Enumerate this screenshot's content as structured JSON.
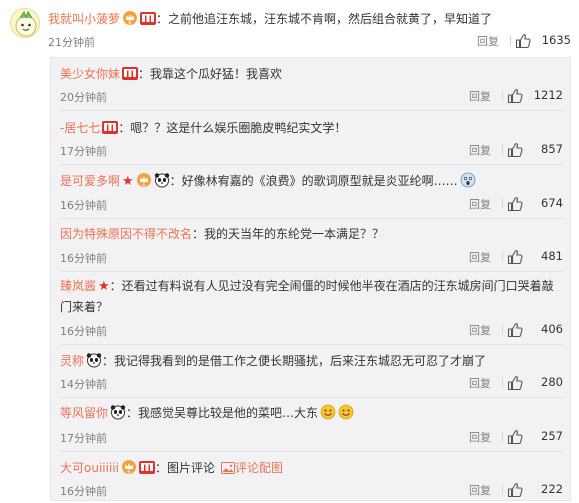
{
  "top_comment": {
    "user": "我就叫小菠萝",
    "text": "：之前他追汪东城，汪东城不肯啊，然后组合就黄了，早知道了",
    "time": "21分钟前",
    "reply_label": "回复",
    "likes": "1635"
  },
  "replies": [
    {
      "user": "美少女你妹",
      "text": "：我靠这个瓜好猛！我喜欢",
      "time": "20分钟前",
      "reply_label": "回复",
      "likes": "1212"
    },
    {
      "user": "-居七七",
      "text": "：嗯？？这是什么娱乐圈脆皮鸭纪实文学！",
      "time": "17分钟前",
      "reply_label": "回复",
      "likes": "857"
    },
    {
      "user": "是可爱多啊",
      "text": "：好像林宥嘉的《浪费》的歌词原型就是炎亚纶啊……",
      "time": "16分钟前",
      "reply_label": "回复",
      "likes": "674"
    },
    {
      "user": "因为特殊原因不得不改名",
      "text": "：我的天当年的东纶党一本满足？？",
      "time": "16分钟前",
      "reply_label": "回复",
      "likes": "481"
    },
    {
      "user": "臻岚酱",
      "text": "：还看过有料说有人见过没有完全闹僵的时候他半夜在酒店的汪东城房间门口哭着敲门来着？",
      "time": "16分钟前",
      "reply_label": "回复",
      "likes": "406"
    },
    {
      "user": "灵称",
      "text": "：我记得我看到的是借工作之便长期骚扰，后来汪东城忍无可忍了才崩了",
      "time": "14分钟前",
      "reply_label": "回复",
      "likes": "280"
    },
    {
      "user": "等风留你",
      "text": "：我感觉吴尊比较是他的菜吧…大东",
      "time": "17分钟前",
      "reply_label": "回复",
      "likes": "257"
    },
    {
      "user": "大可ouiiiiii",
      "text": "：图片评论",
      "pic_link": "评论配图",
      "time": "16分钟前",
      "reply_label": "回复",
      "likes": "222"
    }
  ],
  "icons": {
    "like": "thumbs-up-icon",
    "badge": "red-member-badge-icon",
    "panda": "panda-emoji-icon",
    "star": "red-star-icon",
    "picture": "image-icon"
  },
  "colors": {
    "username": "#eb7350",
    "text": "#333333",
    "meta": "#808080",
    "reply_bg": "#f2f2f5",
    "badge_red": "#e0322b"
  }
}
